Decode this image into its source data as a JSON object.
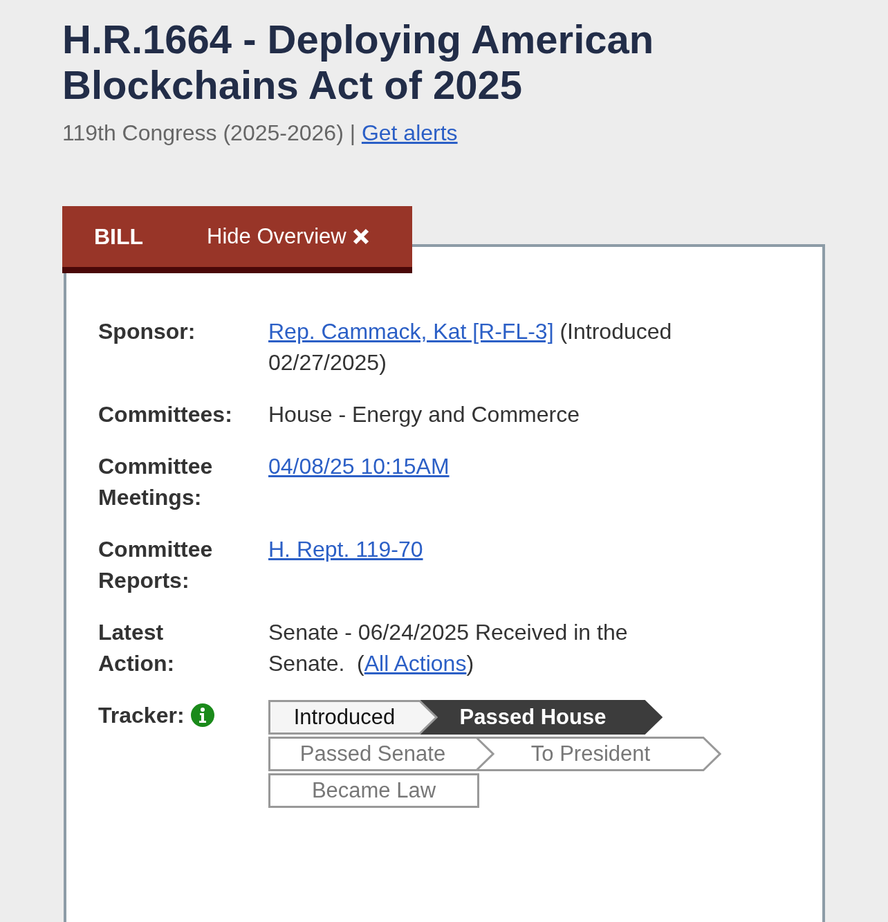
{
  "title": "H.R.1664 - Deploying American Blockchains Act of 2025",
  "subtitle": {
    "congress": "119th Congress (2025-2026) |",
    "alerts_link": "Get alerts"
  },
  "tabs": {
    "label": "BILL",
    "toggle": "Hide Overview"
  },
  "overview": [
    {
      "label": "Sponsor:",
      "parts": [
        {
          "text": "Rep. Cammack, Kat [R-FL-3]",
          "link": true
        },
        {
          "text": " (Introduced 02/27/2025)",
          "link": false
        }
      ]
    },
    {
      "label": "Committees:",
      "parts": [
        {
          "text": "House - Energy and Commerce",
          "link": false
        }
      ]
    },
    {
      "label": "Committee Meetings:",
      "parts": [
        {
          "text": "04/08/25 10:15AM",
          "link": true
        }
      ]
    },
    {
      "label": "Committee Reports:",
      "parts": [
        {
          "text": "H. Rept. 119-70",
          "link": true
        }
      ]
    },
    {
      "label": "Latest Action:",
      "parts": [
        {
          "text": "Senate - 06/24/2025 Received in the Senate.  (",
          "link": false
        },
        {
          "text": "All Actions",
          "link": true
        },
        {
          "text": ")",
          "link": false
        }
      ]
    }
  ],
  "tracker": {
    "label": "Tracker:",
    "steps": [
      {
        "label": "Introduced",
        "completed": true,
        "current": false
      },
      {
        "label": "Passed House",
        "completed": true,
        "current": true
      },
      {
        "label": "Passed Senate",
        "completed": false,
        "current": false
      },
      {
        "label": "To President",
        "completed": false,
        "current": false
      },
      {
        "label": "Became Law",
        "completed": false,
        "current": false
      }
    ]
  }
}
